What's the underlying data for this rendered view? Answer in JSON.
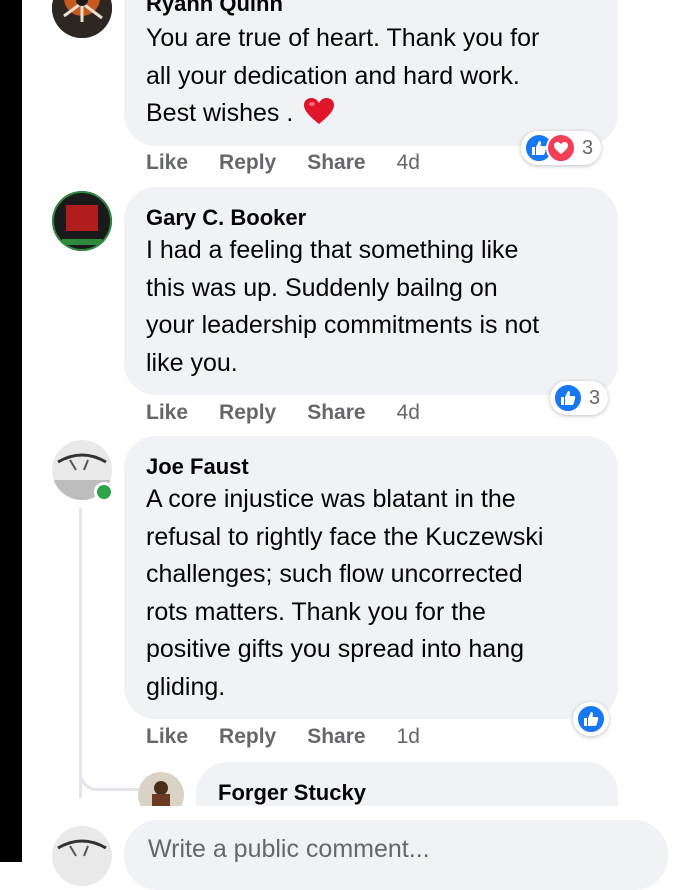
{
  "comments": [
    {
      "author": "Ryann Quinn",
      "text": "You are true of heart. Thank you for\nall your dedication and hard work.\nBest wishes .",
      "emoji": "heart",
      "actions": {
        "like": "Like",
        "reply": "Reply",
        "share": "Share",
        "time": "4d"
      },
      "reactions": {
        "icons": [
          "like-icon",
          "love-icon"
        ],
        "count": "3"
      }
    },
    {
      "author": "Gary C. Booker",
      "text": "I had a feeling that something like\nthis was up. Suddenly bailng on\nyour leadership commitments is not\nlike you.",
      "actions": {
        "like": "Like",
        "reply": "Reply",
        "share": "Share",
        "time": "4d"
      },
      "reactions": {
        "icons": [
          "like-icon"
        ],
        "count": "3"
      }
    },
    {
      "author": "Joe Faust",
      "text": "A core injustice was blatant in the\nrefusal to rightly face the Kuczewski\nchallenges; such flow uncorrected\nrots matters. Thank you for the\npositive gifts you spread into hang\ngliding.",
      "actions": {
        "like": "Like",
        "reply": "Reply",
        "share": "Share",
        "time": "1d"
      },
      "reactions": {
        "icons": [
          "like-icon"
        ]
      },
      "online": true
    },
    {
      "author": "Forger Stucky",
      "is_reply": true
    }
  ],
  "composer": {
    "placeholder": "Write a public comment..."
  },
  "colors": {
    "bubble": "#f0f2f5",
    "like_blue": "#1877f2",
    "love_red": "#f33e58",
    "meta_gray": "#65676b",
    "online_green": "#31a24c"
  }
}
